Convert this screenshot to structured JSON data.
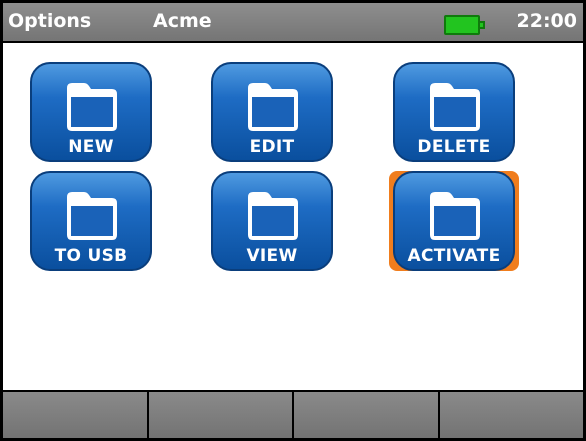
{
  "status_bar": {
    "menu_title": "Options",
    "profile_name": "Acme",
    "time": "22:00",
    "battery_color": "#22c41f"
  },
  "tiles": [
    {
      "label": "NEW",
      "icon": "folder-icon"
    },
    {
      "label": "EDIT",
      "icon": "folder-icon"
    },
    {
      "label": "DELETE",
      "icon": "folder-icon"
    },
    {
      "label": "TO USB",
      "icon": "folder-icon"
    },
    {
      "label": "VIEW",
      "icon": "folder-icon"
    },
    {
      "label": "ACTIVATE",
      "icon": "folder-icon",
      "selected": true
    }
  ],
  "softkeys": [
    "",
    "",
    "",
    ""
  ],
  "colors": {
    "tile_blue": "#1e6cc4",
    "selection_orange": "#f07d1d",
    "title_bar": "#808080"
  }
}
